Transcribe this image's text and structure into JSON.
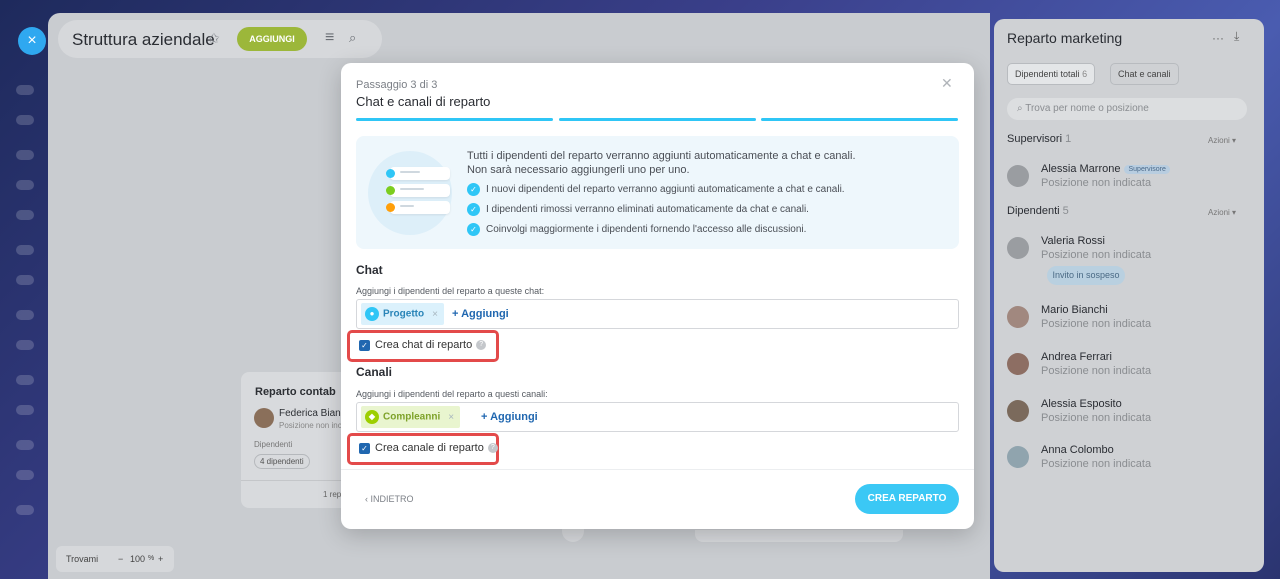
{
  "header": {
    "title": "Struttura aziendale",
    "add_button": "AGGIUNGI",
    "close_icon": "×"
  },
  "dept_card": {
    "title": "Reparto contab",
    "person_name": "Federica Bianc",
    "person_position": "Posizione non inc",
    "employees_label": "Dipendenti",
    "employees_badge": "4 dipendenti",
    "footer": "1 rep"
  },
  "zoom": {
    "find": "Trovami",
    "minus": "−",
    "value": "100",
    "unit": "%",
    "plus": "+"
  },
  "right_panel": {
    "title": "Reparto marketing",
    "tabs": [
      {
        "label": "Dipendenti totali",
        "count": "6"
      },
      {
        "label": "Chat e canali",
        "count": ""
      }
    ],
    "search_placeholder": "Trova per nome o posizione",
    "supervisors": {
      "label": "Supervisori",
      "count": "1",
      "actions": "Azioni"
    },
    "employees": {
      "label": "Dipendenti",
      "count": "5",
      "actions": "Azioni"
    },
    "people": [
      {
        "name": "Alessia Marrone",
        "position": "Posizione non indicata",
        "badge": "Supervisore"
      },
      {
        "name": "Valeria Rossi",
        "position": "Posizione non indicata",
        "badge": "Invito in sospeso"
      },
      {
        "name": "Mario Bianchi",
        "position": "Posizione non indicata"
      },
      {
        "name": "Andrea Ferrari",
        "position": "Posizione non indicata"
      },
      {
        "name": "Alessia Esposito",
        "position": "Posizione non indicata"
      },
      {
        "name": "Anna Colombo",
        "position": "Posizione non indicata"
      }
    ]
  },
  "modal": {
    "step": "Passaggio 3 di 3",
    "title": "Chat e canali di reparto",
    "info_intro_1": "Tutti i dipendenti del reparto verranno aggiunti automaticamente a chat e canali.",
    "info_intro_2": "Non sarà necessario aggiungerli uno per uno.",
    "info_items": [
      "I nuovi dipendenti del reparto verranno aggiunti automaticamente a chat e canali.",
      "I dipendenti rimossi verranno eliminati automaticamente da chat e canali.",
      "Coinvolgi maggiormente i dipendenti fornendo l'accesso alle discussioni."
    ],
    "chat": {
      "title": "Chat",
      "subtitle": "Aggiungi i dipendenti del reparto a queste chat:",
      "tag": "Progetto",
      "add": "+ Aggiungi",
      "checkbox_label": "Crea chat di reparto"
    },
    "channels": {
      "title": "Canali",
      "subtitle": "Aggiungi i dipendenti del reparto a questi canali:",
      "tag": "Compleanni",
      "add": "+ Aggiungi",
      "checkbox_label": "Crea canale di reparto"
    },
    "back": "INDIETRO",
    "create": "CREA REPARTO"
  },
  "colors": {
    "accent": "#2fc6f6",
    "add_green": "#9cb73a",
    "highlight_red": "#e34a4a",
    "link_blue": "#2067b0"
  }
}
